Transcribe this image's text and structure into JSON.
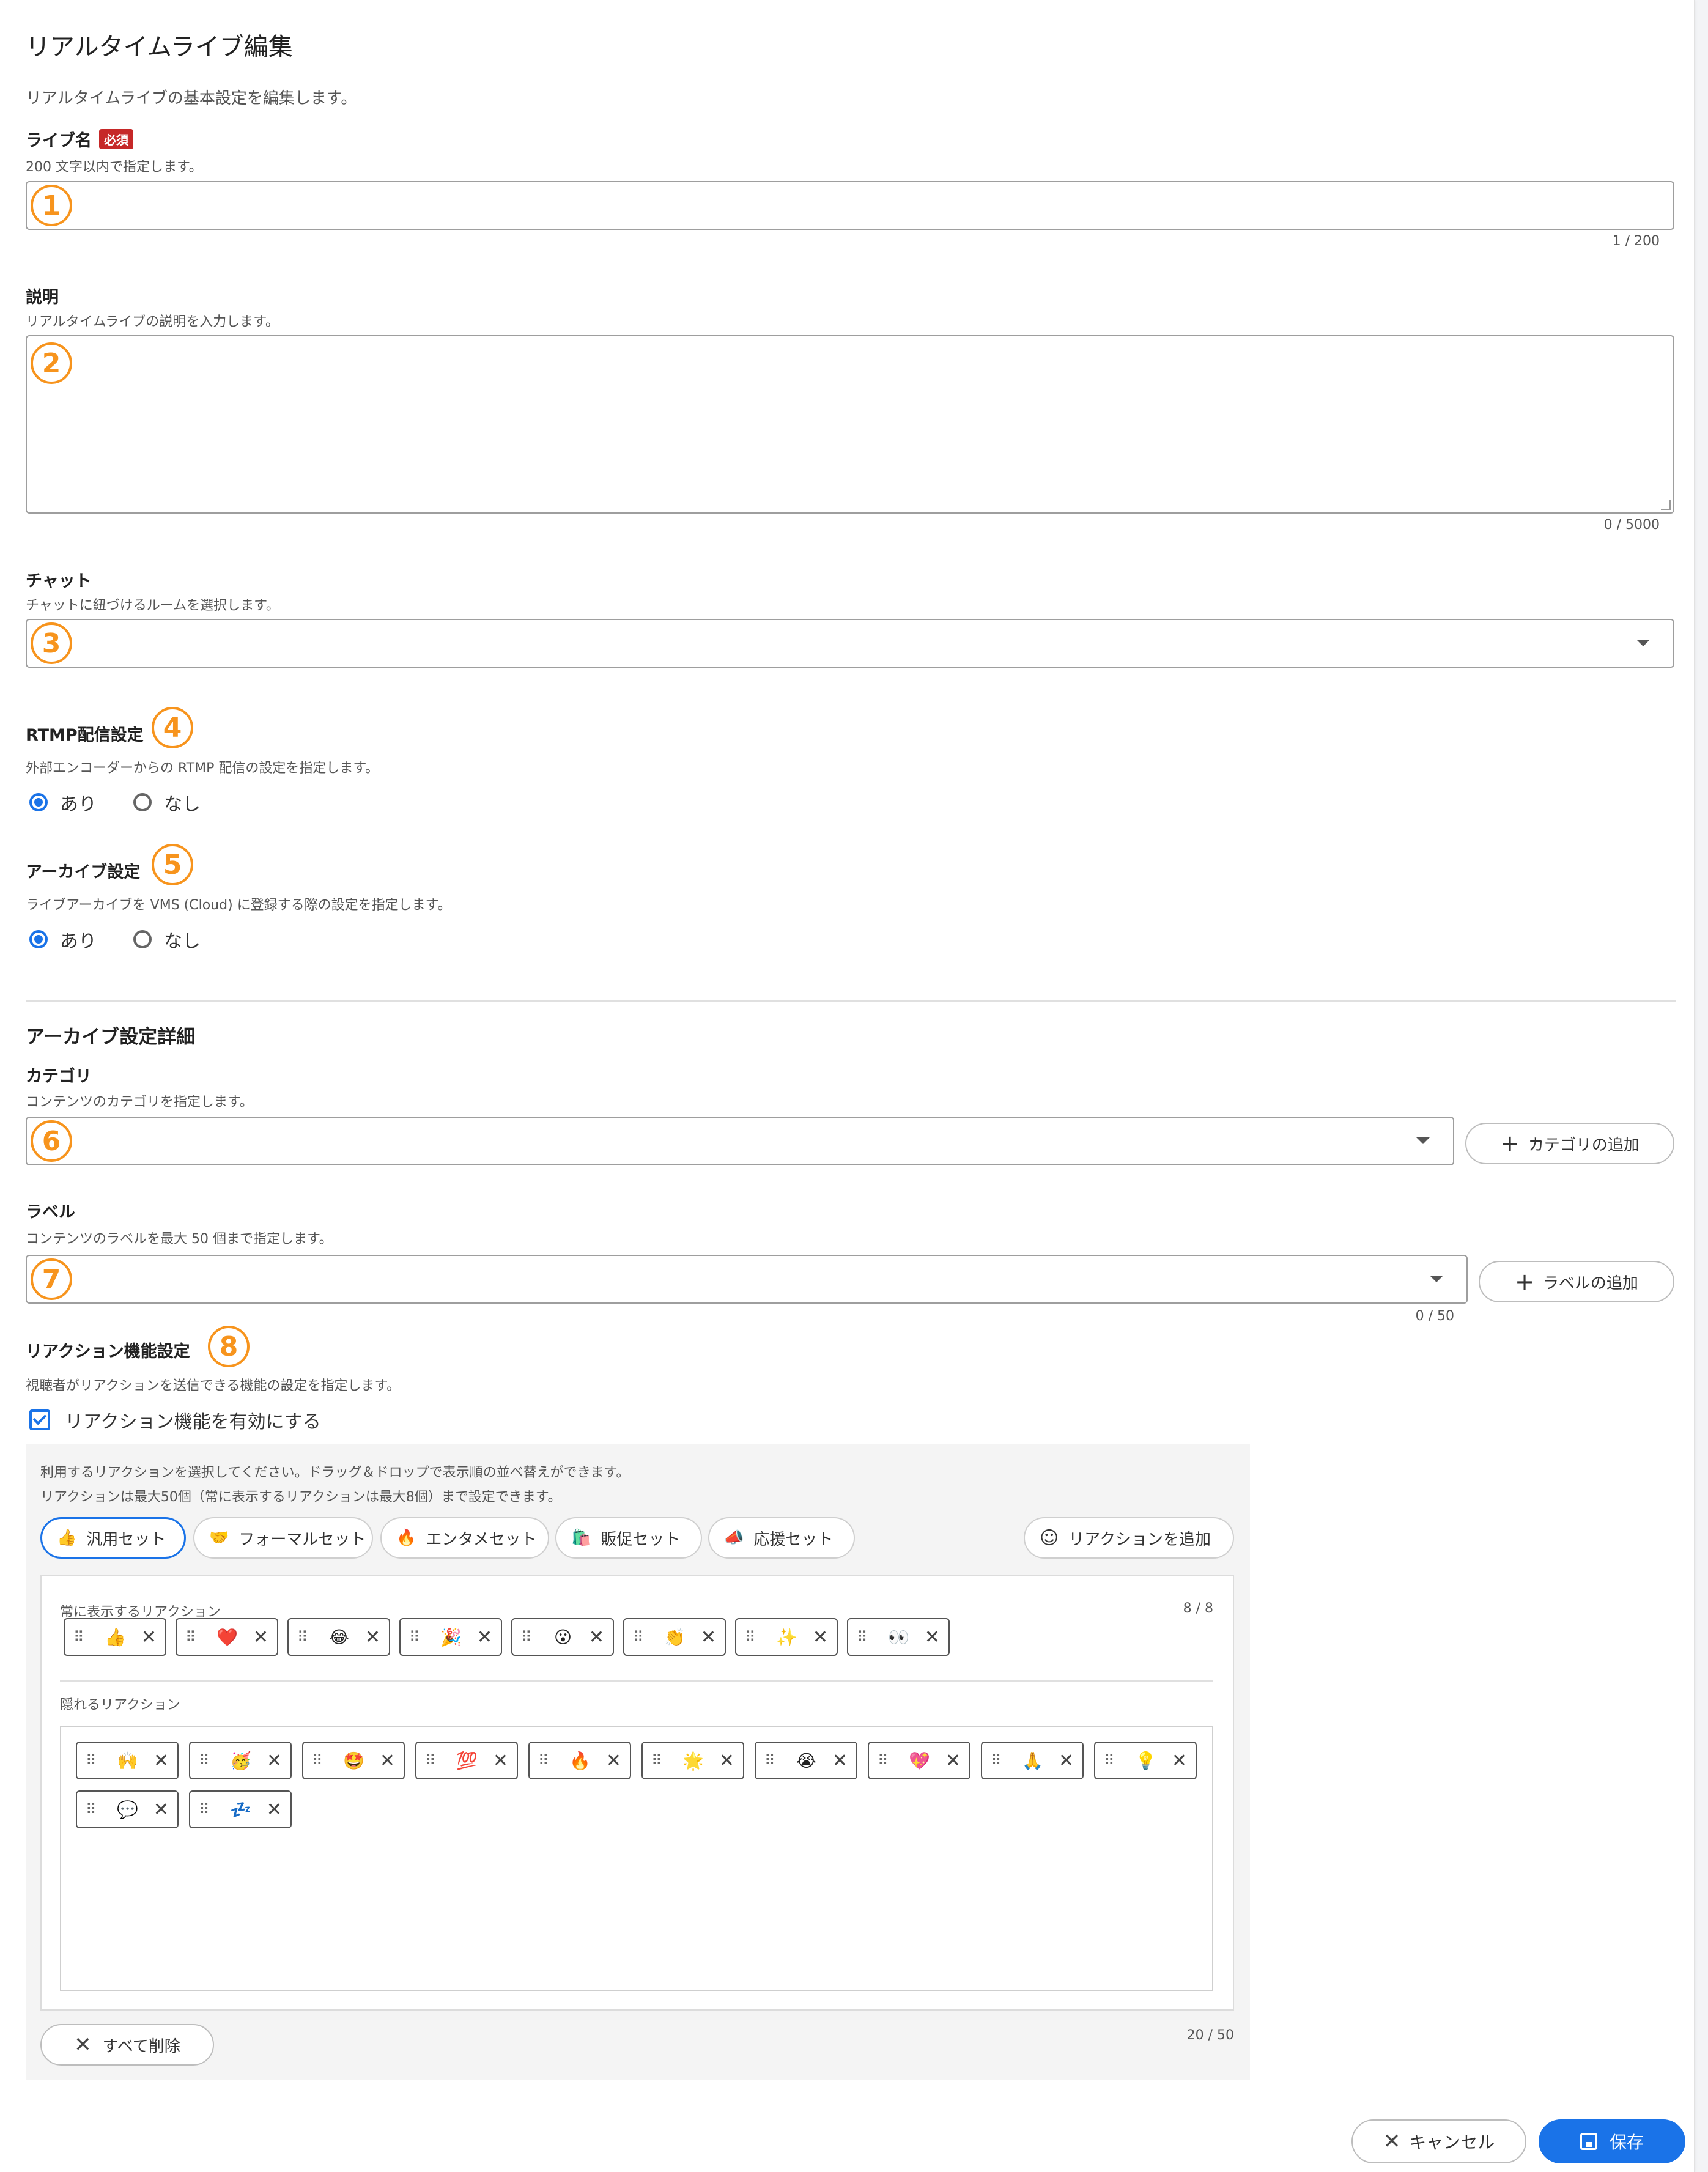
{
  "page": {
    "title": "リアルタイムライブ編集",
    "description": "リアルタイムライブの基本設定を編集します。"
  },
  "live_name": {
    "label": "ライブ名",
    "required_badge": "必須",
    "help": "200 文字以内で指定します。",
    "value": "",
    "counter": "1 / 200",
    "callout": "1"
  },
  "description": {
    "label": "説明",
    "help": "リアルタイムライブの説明を入力します。",
    "value": "",
    "counter": "0 / 5000",
    "callout": "2"
  },
  "chat": {
    "label": "チャット",
    "help": "チャットに紐づけるルームを選択します。",
    "selected": "",
    "callout": "3"
  },
  "rtmp": {
    "label": "RTMP配信設定",
    "help": "外部エンコーダーからの RTMP 配信の設定を指定します。",
    "options": [
      "あり",
      "なし"
    ],
    "selected": "あり",
    "callout": "4"
  },
  "archive": {
    "label": "アーカイブ設定",
    "help": "ライブアーカイブを VMS (Cloud) に登録する際の設定を指定します。",
    "options": [
      "あり",
      "なし"
    ],
    "selected": "あり",
    "callout": "5"
  },
  "archive_detail": {
    "title": "アーカイブ設定詳細"
  },
  "category": {
    "label": "カテゴリ",
    "help": "コンテンツのカテゴリを指定します。",
    "selected": "",
    "add_label": "カテゴリの追加",
    "callout": "6"
  },
  "labels": {
    "label": "ラベル",
    "help": "コンテンツのラベルを最大 50 個まで指定します。",
    "selected": "",
    "add_label": "ラベルの追加",
    "counter": "0 / 50",
    "callout": "7"
  },
  "reaction": {
    "label": "リアクション機能設定",
    "help": "視聴者がリアクションを送信できる機能の設定を指定します。",
    "enable_label": "リアクション機能を有効にする",
    "enabled": true,
    "callout": "8",
    "instructions_1": "利用するリアクションを選択してください。ドラッグ＆ドロップで表示順の並べ替えができます。",
    "instructions_2": "リアクションは最大50個（常に表示するリアクションは最大8個）まで設定できます。",
    "sets": [
      {
        "icon": "👍",
        "label": "汎用セット",
        "active": true
      },
      {
        "icon": "🤝",
        "label": "フォーマルセット",
        "active": false
      },
      {
        "icon": "🔥",
        "label": "エンタメセット",
        "active": false
      },
      {
        "icon": "🛍️",
        "label": "販促セット",
        "active": false
      },
      {
        "icon": "📣",
        "label": "応援セット",
        "active": false
      }
    ],
    "add_reaction_label": "リアクションを追加",
    "always_label": "常に表示するリアクション",
    "always_counter": "8 / 8",
    "always": [
      "👍",
      "❤️",
      "😂",
      "🎉",
      "😮",
      "👏",
      "✨",
      "👀"
    ],
    "hidden_label": "隠れるリアクション",
    "hidden": [
      "🙌",
      "🥳",
      "🤩",
      "💯",
      "🔥",
      "🌟",
      "😭",
      "💖",
      "🙏",
      "💡",
      "💬",
      "💤"
    ],
    "total_counter": "20 / 50",
    "clear_all_label": "すべて削除"
  },
  "footer": {
    "cancel_label": "キャンセル",
    "save_label": "保存"
  },
  "colors": {
    "accent": "#1a73e8",
    "callout": "#f7941d",
    "required": "#c62828"
  }
}
